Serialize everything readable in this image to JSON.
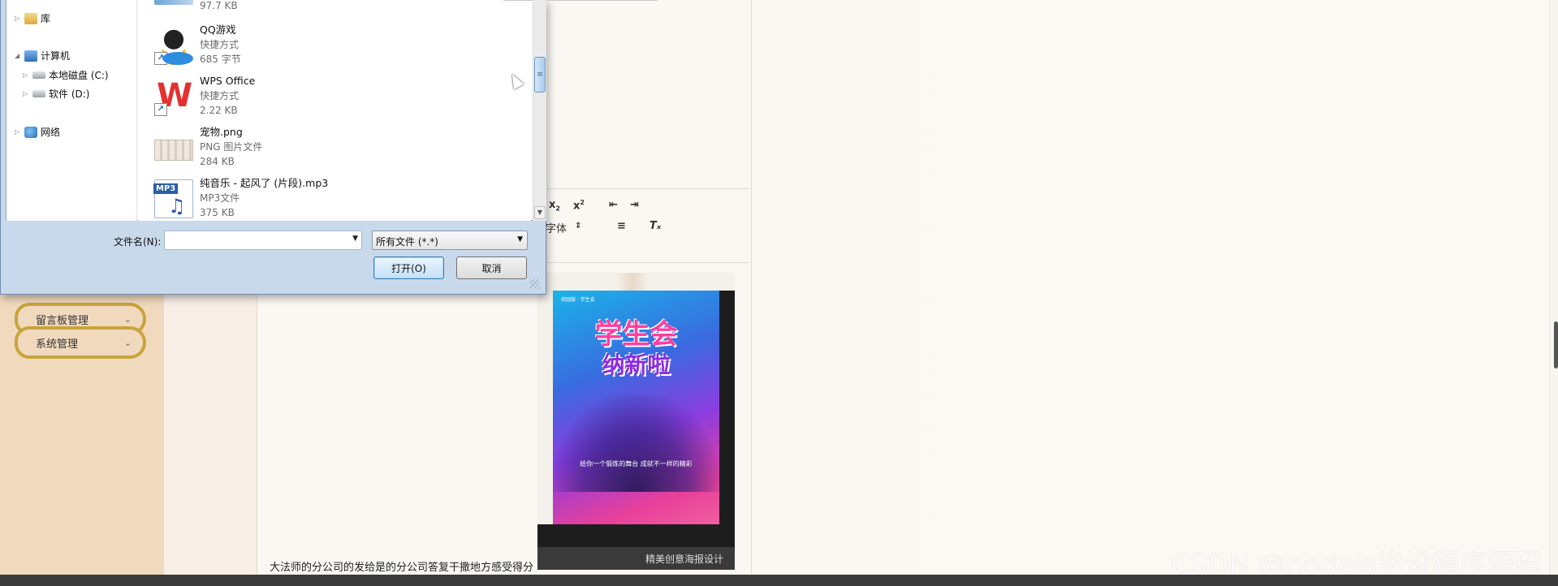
{
  "background": {
    "sidebar_menu": [
      {
        "label": "留言板管理"
      },
      {
        "label": "系统管理"
      }
    ],
    "editor_toolbar": {
      "sub": "x",
      "sub_mark": "2",
      "sup": "x",
      "sup_mark": "2",
      "font": "字体"
    },
    "poster": {
      "tag": "校园版 · 学生会",
      "title_line1": "学生会",
      "title_line2": "纳新啦",
      "slogan": "给你一个锻炼的舞台 成就不一样的精彩",
      "caption": "精美创意海报设计"
    },
    "body_text": "大法师的分公司的发给是的分公司答复干撒地方感受得分",
    "watermark": "CSDN @nodejs毕设程序源码"
  },
  "dialog": {
    "nav": {
      "library": "库",
      "computer": "计算机",
      "disk_c": "本地磁盘 (C:)",
      "disk_d": "软件 (D:)",
      "network": "网络"
    },
    "files": [
      {
        "name": "",
        "type": "",
        "size": "97.7 KB"
      },
      {
        "name": "QQ游戏",
        "type": "快捷方式",
        "size": "685 字节"
      },
      {
        "name": "WPS Office",
        "type": "快捷方式",
        "size": "2.22 KB"
      },
      {
        "name": "宠物.png",
        "type": "PNG 图片文件",
        "size": "284 KB"
      },
      {
        "name": "纯音乐 - 起风了 (片段).mp3",
        "type": "MP3文件",
        "size": "375 KB"
      }
    ],
    "filename_label": "文件名(N):",
    "filename_value": "",
    "filetype_value": "所有文件 (*.*)",
    "open_button": "打开(O)",
    "cancel_button": "取消",
    "mp3_badge": "MP3",
    "wps_glyph": "W"
  }
}
